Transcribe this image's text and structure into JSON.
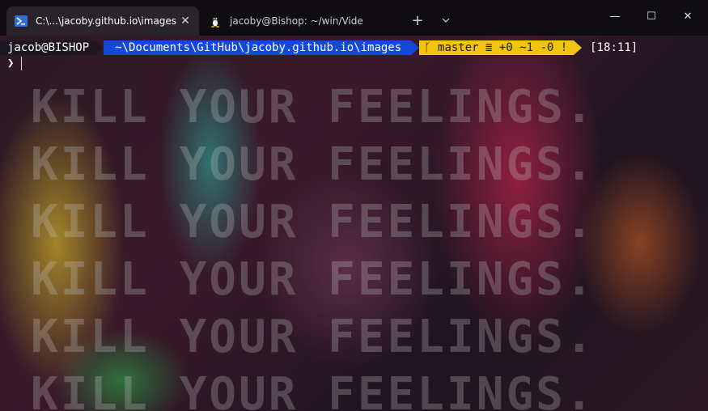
{
  "tabs": [
    {
      "label": "C:\\...\\jacoby.github.io\\images",
      "icon": "powershell-icon",
      "active": true
    },
    {
      "label": "jacoby@Bishop: ~/win/Videos/",
      "icon": "linux-tux-icon",
      "active": false
    }
  ],
  "titlebar": {
    "new_tab": "+",
    "dropdown": "⌄"
  },
  "window_controls": {
    "minimize": "—",
    "maximize": "☐",
    "close": "✕"
  },
  "prompt": {
    "user": "jacob@BISHOP",
    "path": "~\\Documents\\GitHub\\jacoby.github.io\\images",
    "git": "master ≣ +0 ~1 -0 !",
    "time": "[18:11]",
    "symbol": "❯"
  },
  "background_text": "KILL YOUR FEELINGS.",
  "colors": {
    "path_bg": "#1448d8",
    "git_bg": "#f1c40f",
    "titlebar_bg": "#0f0d12"
  }
}
